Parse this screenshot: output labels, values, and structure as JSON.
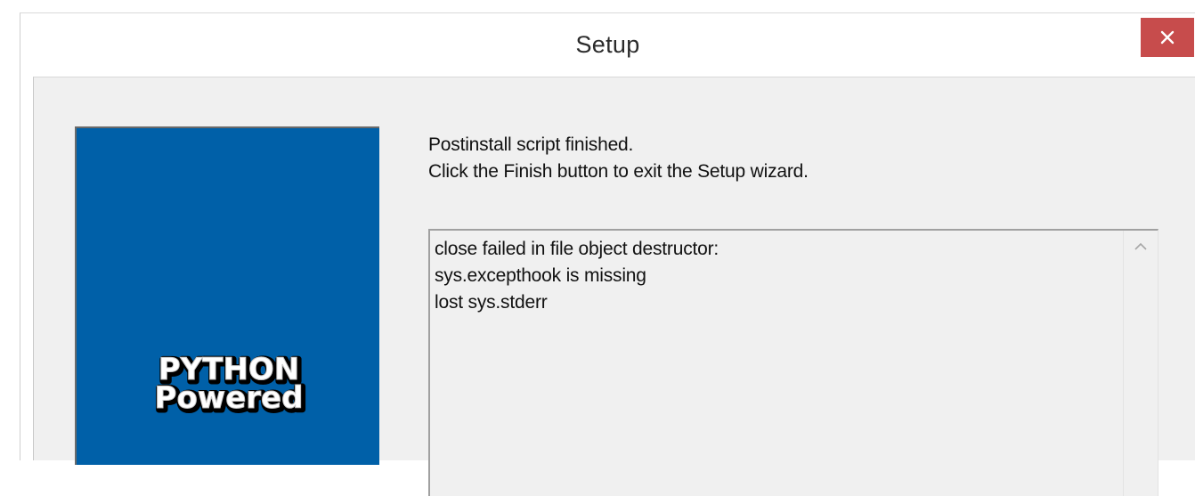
{
  "window": {
    "title": "Setup",
    "close_label": "✕"
  },
  "banner": {
    "logo_line_1": "PYTHON",
    "logo_line_2": "Powered",
    "background_color": "#0060a8"
  },
  "message": {
    "line_1": "Postinstall script finished.",
    "line_2": "Click the Finish button to exit the Setup wizard."
  },
  "log": {
    "lines": [
      "close failed in file object destructor:",
      "sys.excepthook is missing",
      "lost sys.stderr"
    ]
  },
  "icons": {
    "close": "close-icon",
    "scroll_up": "chevron-up-icon"
  },
  "colors": {
    "close_button": "#c74c4c",
    "dialog_background": "#f0f0f0"
  }
}
